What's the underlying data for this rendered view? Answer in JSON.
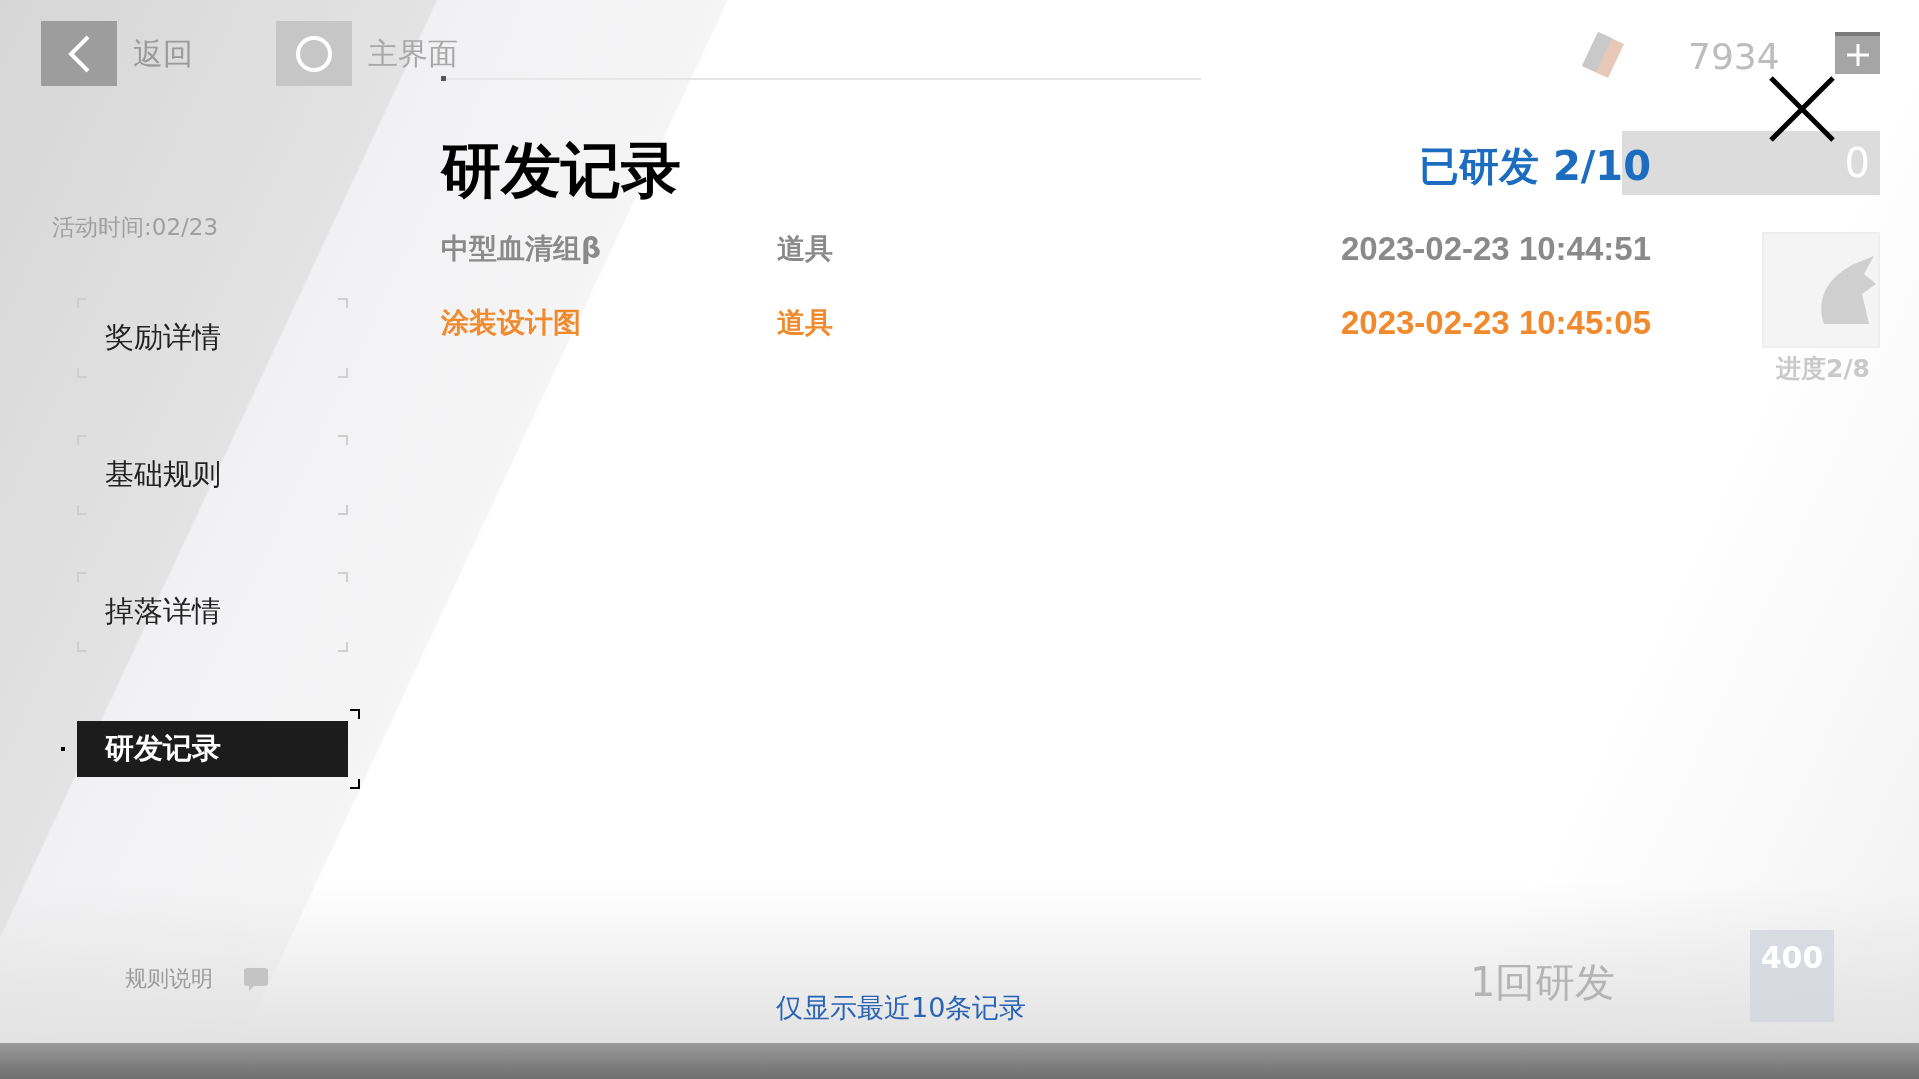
{
  "top_bar": {
    "back_label": "返回",
    "home_label": "主界面",
    "currency": "7934"
  },
  "background": {
    "event_time": "活动时间:02/23",
    "stock": "0",
    "progress": "进度2/8",
    "rules": "规则说明",
    "action": "1回研发",
    "cost": "400"
  },
  "sidebar": {
    "tabs": [
      {
        "label": "奖励详情",
        "selected": false
      },
      {
        "label": "基础规则",
        "selected": false
      },
      {
        "label": "掉落详情",
        "selected": false
      },
      {
        "label": "研发记录",
        "selected": true
      }
    ]
  },
  "panel": {
    "title": "研发记录",
    "summary": "已研发 2/10",
    "records": [
      {
        "name": "中型血清组β",
        "category": "道具",
        "time": "2023-02-23 10:44:51",
        "highlighted": false
      },
      {
        "name": "涂装设计图",
        "category": "道具",
        "time": "2023-02-23 10:45:05",
        "highlighted": true
      }
    ],
    "note": "仅显示最近10条记录"
  }
}
